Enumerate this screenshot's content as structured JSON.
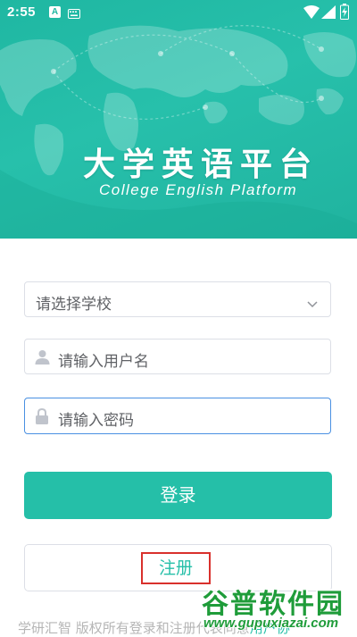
{
  "status_bar": {
    "time": "2:55",
    "notification_badge": "A",
    "icons": [
      "keyboard-icon",
      "wifi-icon",
      "signal-icon",
      "battery-icon"
    ]
  },
  "header": {
    "title": "大学英语平台",
    "subtitle": "College English Platform",
    "background_color": "#1fb7a2"
  },
  "form": {
    "school_select": {
      "placeholder": "请选择学校",
      "icon": "chevron-down-icon"
    },
    "username": {
      "placeholder": "请输入用户名",
      "icon": "user-icon"
    },
    "password": {
      "placeholder": "请输入密码",
      "icon": "lock-icon"
    }
  },
  "actions": {
    "login_label": "登录",
    "register_label": "注册"
  },
  "footer": {
    "text": "学研汇智 版权所有登录和注册代表同意",
    "link_text": "用户协"
  },
  "watermark": {
    "name": "谷普软件园",
    "url": "www.gupuxiazai.com"
  },
  "colors": {
    "accent": "#25bfa8",
    "focus_border": "#4a90e2",
    "highlight_box": "#d9302c"
  }
}
